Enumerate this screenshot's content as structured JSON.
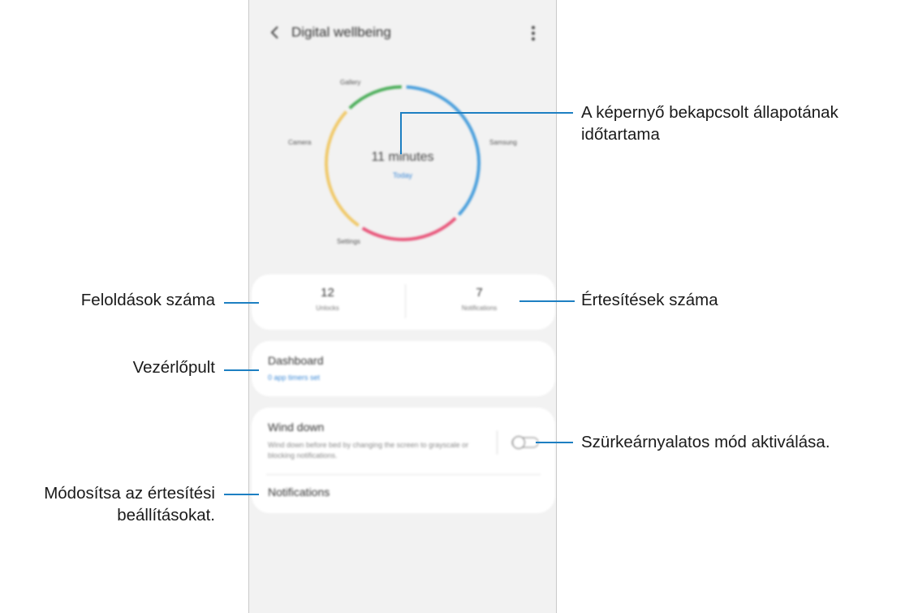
{
  "app": {
    "title": "Digital wellbeing",
    "donut": {
      "center_time": "11 minutes",
      "center_link": "Today",
      "labels": [
        "Gallery",
        "Camera",
        "Samsung",
        "Settings"
      ],
      "segments": [
        {
          "color": "#4a9fdc",
          "share": 0.37
        },
        {
          "color": "#e8577b",
          "share": 0.22
        },
        {
          "color": "#f0c96a",
          "share": 0.28
        },
        {
          "color": "#4cae5a",
          "share": 0.13
        }
      ]
    },
    "stats": {
      "unlocks_value": "12",
      "unlocks_label": "Unlocks",
      "notifications_value": "7",
      "notifications_label": "Notifications"
    },
    "dashboard": {
      "title": "Dashboard",
      "subtitle": "0 app timers set"
    },
    "wind_down": {
      "title": "Wind down",
      "description": "Wind down before bed by changing the screen to grayscale or blocking notifications.",
      "notifications_label": "Notifications"
    }
  },
  "callouts": {
    "screen_time": [
      "A képernyő bekapcsolt állapotának",
      "időtartama"
    ],
    "unlocks": "Feloldások száma",
    "notifications": "Értesítések száma",
    "dashboard": "Vezérlőpult",
    "grayscale": "Szürkeárnyalatos mód aktiválása.",
    "notif_settings": [
      "Módosítsa az értesítési",
      "beállításokat."
    ]
  },
  "colors": {
    "callout_line": "#1d7fc2",
    "link_blue": "#3a88d6",
    "background_phone": "#f2f2f2"
  }
}
